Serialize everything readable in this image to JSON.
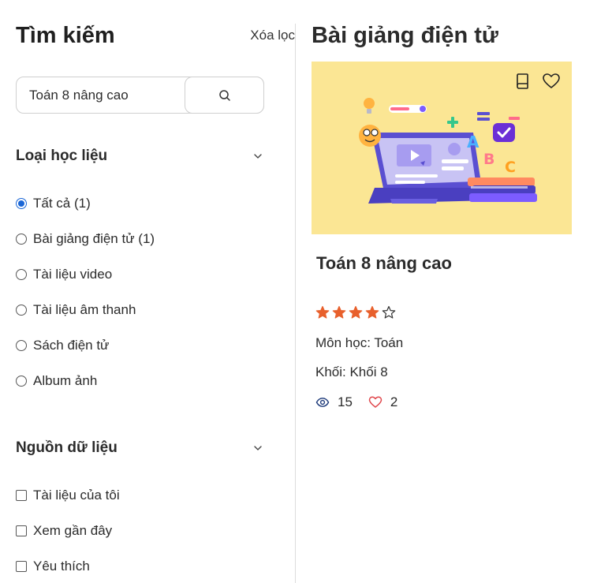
{
  "sidebar": {
    "title": "Tìm kiếm",
    "clear_label": "Xóa lọc",
    "search": {
      "value": "Toán 8 nâng cao"
    },
    "material_type": {
      "title": "Loại học liệu",
      "options": [
        {
          "label": "Tất cả (1)",
          "selected": true
        },
        {
          "label": "Bài giảng điện tử (1)",
          "selected": false
        },
        {
          "label": "Tài liệu video",
          "selected": false
        },
        {
          "label": "Tài liệu âm thanh",
          "selected": false
        },
        {
          "label": "Sách điện tử",
          "selected": false
        },
        {
          "label": "Album ảnh",
          "selected": false
        }
      ]
    },
    "data_source": {
      "title": "Nguồn dữ liệu",
      "options": [
        {
          "label": "Tài liệu của tôi",
          "checked": false
        },
        {
          "label": "Xem gần đây",
          "checked": false
        },
        {
          "label": "Yêu thích",
          "checked": false
        }
      ]
    }
  },
  "main": {
    "title": "Bài giảng điện tử",
    "card": {
      "title": "Toán 8 nâng cao",
      "rating": 4,
      "rating_max": 5,
      "subject": "Môn học: Toán",
      "grade": "Khối: Khối 8",
      "views": "15",
      "likes": "2",
      "thumbnail_bg": "#fbe694"
    }
  },
  "colors": {
    "accent": "#1a66d6",
    "star": "#e8602c",
    "heart": "#e0474c",
    "divider": "#dcdcdc"
  }
}
